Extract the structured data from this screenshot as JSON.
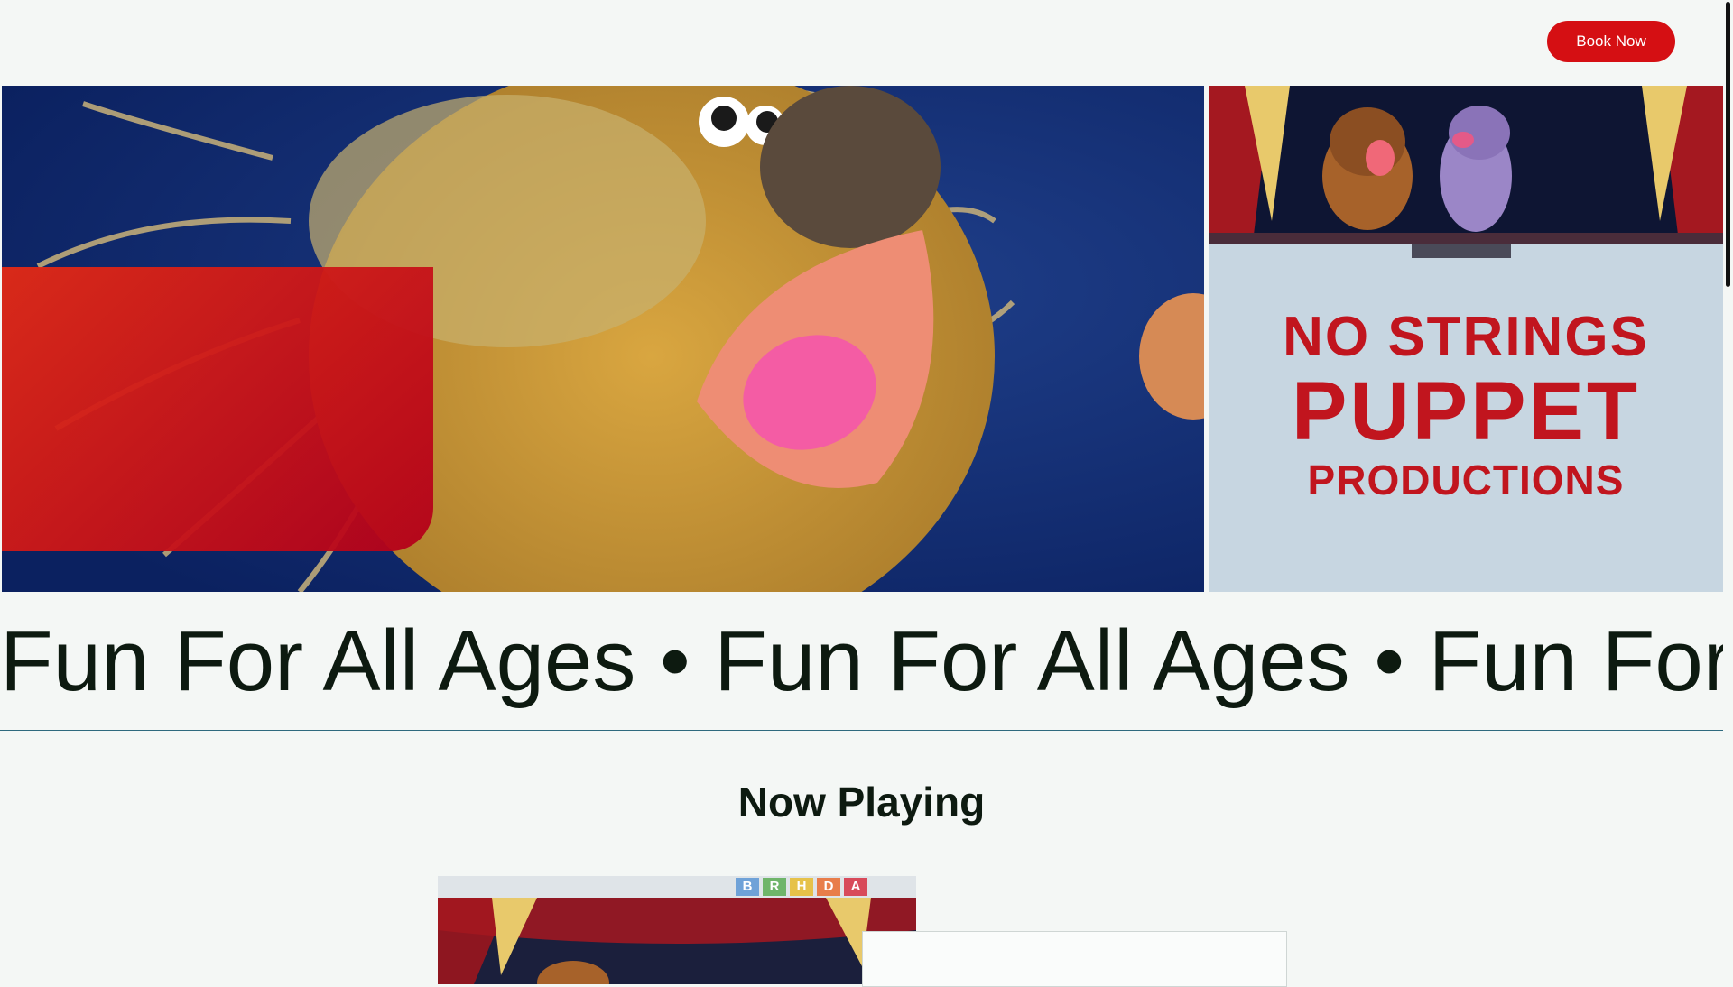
{
  "header": {
    "book_label": "Book Now"
  },
  "hero": {
    "sign_lines": [
      "NO STRINGS",
      "PUPPET",
      "PRODUCTIONS"
    ]
  },
  "ticker": {
    "text": "Fun For All Ages  •  Fun For All Ages  •  Fun For All Ages  •  Fun For All Ages"
  },
  "now_playing": {
    "title": "Now Playing",
    "blocks": [
      "B",
      "R",
      "H",
      "D",
      "A"
    ]
  },
  "colors": {
    "accent": "#d50f13",
    "background": "#f4f7f5",
    "text": "#0d1a10"
  }
}
